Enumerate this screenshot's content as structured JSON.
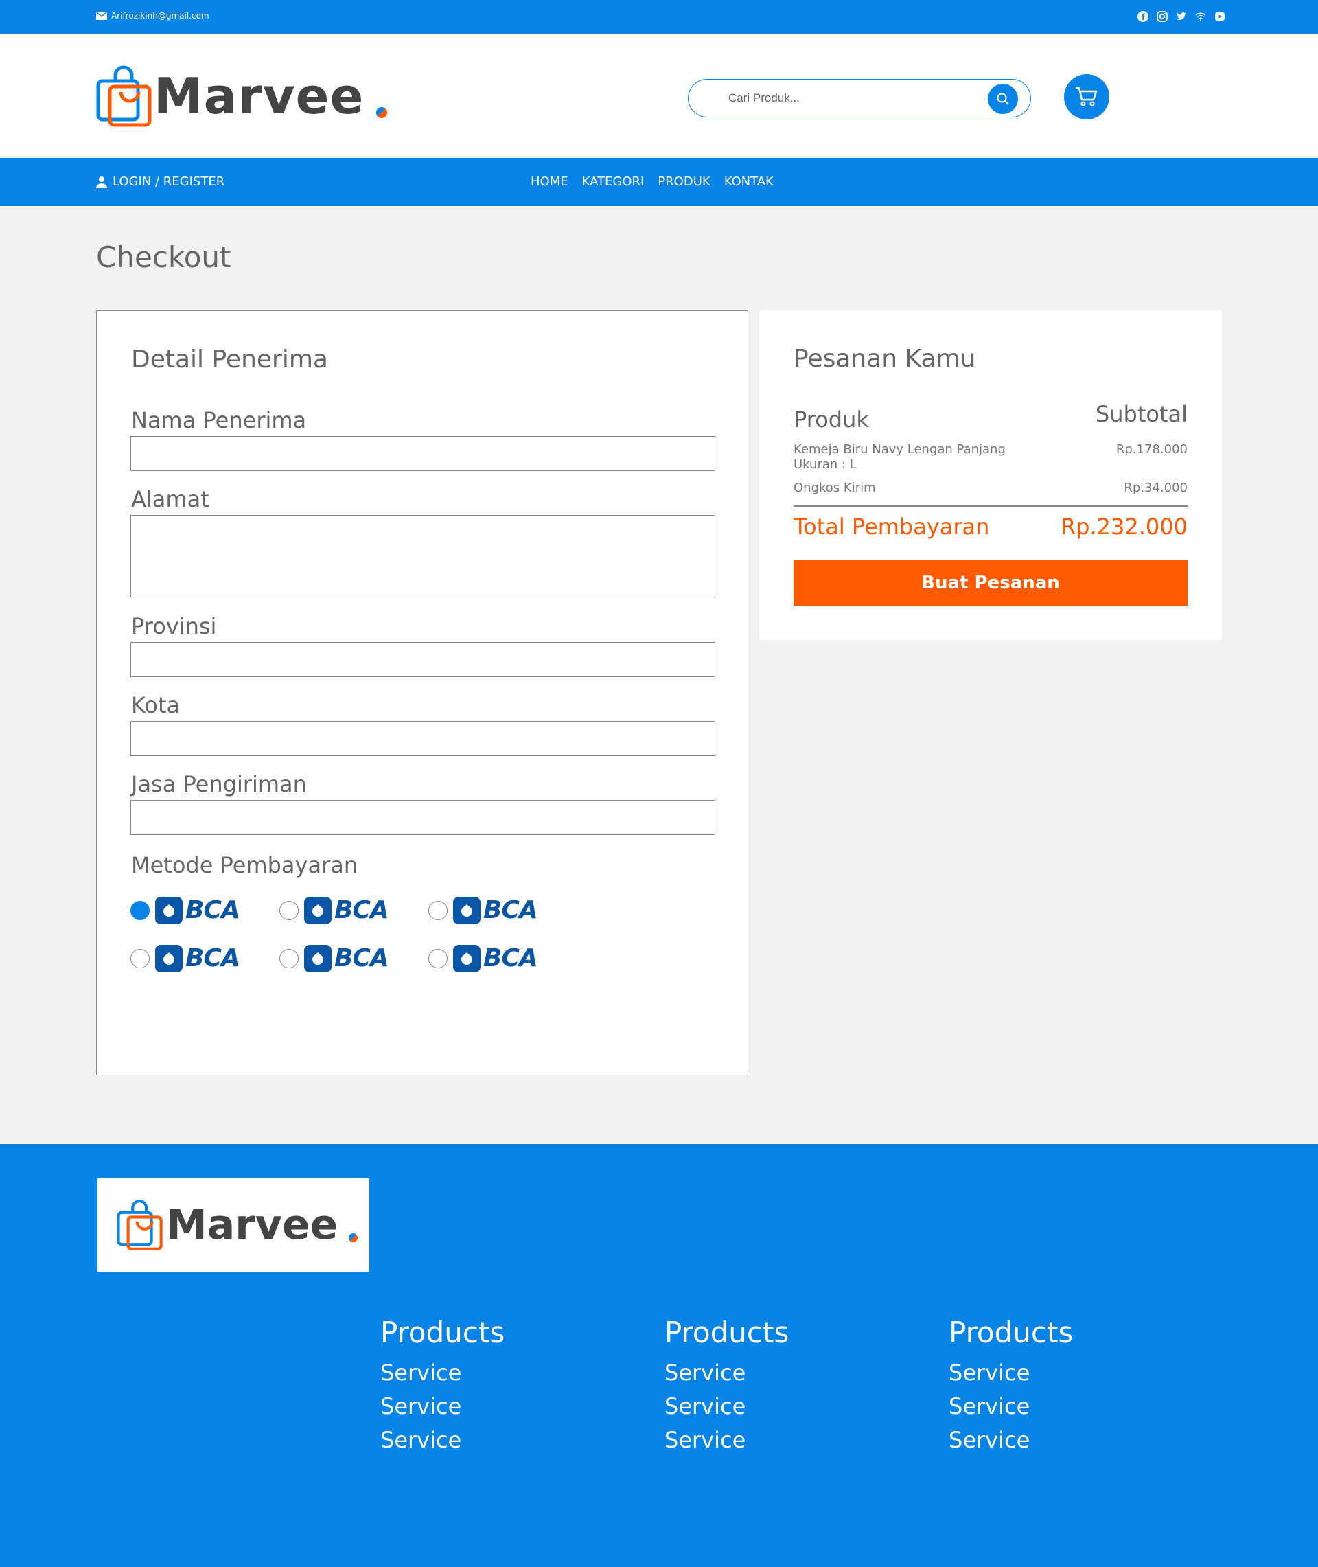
{
  "topbar": {
    "email": "Arifrozikinh@gmail.com",
    "socials": [
      "facebook-icon",
      "instagram-icon",
      "twitter-icon",
      "wifi-icon",
      "youtube-icon"
    ]
  },
  "header": {
    "brand": "Marvee",
    "search_placeholder": "Cari Produk...",
    "colors": {
      "primary": "#0884e6",
      "accent": "#ff5a00"
    }
  },
  "nav": {
    "login": "LOGIN / REGISTER",
    "items": [
      "HOME",
      "KATEGORI",
      "PRODUK",
      "KONTAK"
    ]
  },
  "checkout": {
    "title": "Checkout",
    "recipient": {
      "heading": "Detail Penerima",
      "fields": [
        {
          "label": "Nama Penerima",
          "value": ""
        },
        {
          "label": "Alamat",
          "value": ""
        },
        {
          "label": "Provinsi",
          "value": ""
        },
        {
          "label": "Kota",
          "value": ""
        },
        {
          "label": "Jasa Pengiriman",
          "value": ""
        }
      ],
      "payment_label": "Metode Pembayaran",
      "payment_options": [
        {
          "bank": "BCA",
          "selected": true
        },
        {
          "bank": "BCA",
          "selected": false
        },
        {
          "bank": "BCA",
          "selected": false
        },
        {
          "bank": "BCA",
          "selected": false
        },
        {
          "bank": "BCA",
          "selected": false
        },
        {
          "bank": "BCA",
          "selected": false
        }
      ]
    },
    "order": {
      "heading": "Pesanan Kamu",
      "col_product": "Produk",
      "col_subtotal": "Subtotal",
      "item_name": "Kemeja Biru Navy Lengan Panjang Ukuran : L",
      "item_price": "Rp.178.000",
      "shipping_label": "Ongkos Kirim",
      "shipping_price": "Rp.34.000",
      "total_label": "Total Pembayaran",
      "total_price": "Rp.232.000",
      "button": "Buat Pesanan"
    }
  },
  "footer": {
    "brand": "Marvee",
    "columns": [
      {
        "title": "Products",
        "links": [
          "Service",
          "Service",
          "Service"
        ]
      },
      {
        "title": "Products",
        "links": [
          "Service",
          "Service",
          "Service"
        ]
      },
      {
        "title": "Products",
        "links": [
          "Service",
          "Service",
          "Service"
        ]
      }
    ]
  }
}
